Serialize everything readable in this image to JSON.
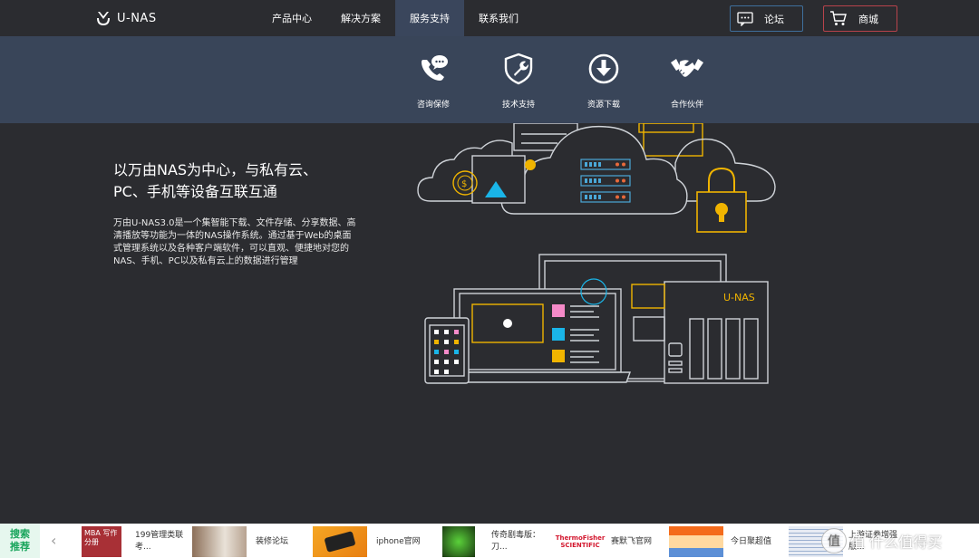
{
  "header": {
    "logo_text": "U-NAS",
    "nav": [
      "产品中心",
      "解决方案",
      "服务支持",
      "联系我们"
    ],
    "forum_label": "论坛",
    "mall_label": "商城"
  },
  "dropdown": {
    "items": [
      {
        "label": "咨询保修",
        "icon": "phone-chat-icon"
      },
      {
        "label": "技术支持",
        "icon": "wrench-shield-icon"
      },
      {
        "label": "资源下载",
        "icon": "download-icon"
      },
      {
        "label": "合作伙伴",
        "icon": "handshake-icon"
      }
    ]
  },
  "hero": {
    "headline_line1": "以万由NAS为中心，与私有云、",
    "headline_line2": "PC、手机等设备互联互通",
    "description": "万由U-NAS3.0是一个集智能下载、文件存储、分享数据、高清播放等功能为一体的NAS操作系统。通过基于Web的桌面式管理系统以及各种客户端软件，可以直观、便捷地对您的NAS、手机、PC以及私有云上的数据进行管理",
    "device_label": "U-NAS"
  },
  "bottom": {
    "search_label_1": "搜索",
    "search_label_2": "推荐",
    "ads": [
      {
        "text": "199管理类联考...",
        "thumb_text": "MBA 写作分册"
      },
      {
        "text": "装修论坛",
        "thumb_text": ""
      },
      {
        "text": "iphone官网",
        "thumb_text": ""
      },
      {
        "text": "传奇剧毒版：刀...",
        "thumb_text": ""
      },
      {
        "text": "赛默飞官网",
        "thumb_text": "ThermoFisher SCIENTIFIC"
      },
      {
        "text": "今日聚超值",
        "thumb_text": ""
      },
      {
        "text": "上游证券增强版...",
        "thumb_text": ""
      }
    ],
    "watermark_text": "值 什么值得买"
  },
  "colors": {
    "background": "#2b2c30",
    "dropdown": "#394559",
    "accent_yellow": "#f0b400",
    "forum_border": "#3f6f9c",
    "mall_border": "#b8434b"
  }
}
